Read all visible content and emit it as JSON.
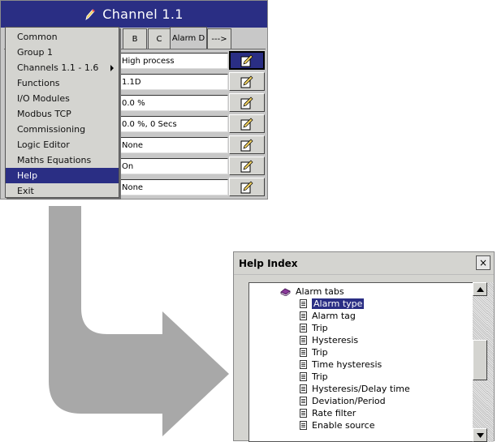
{
  "channel_window": {
    "title": "Channel 1.1",
    "title_icon": "pen-icon",
    "tabs": [
      "B",
      "C",
      "Alarm D",
      "--->"
    ],
    "active_tab": "Alarm D",
    "fields": [
      "High process",
      "1.1D",
      "0.0 %",
      "0.0 %, 0 Secs",
      "None",
      "On",
      "None"
    ],
    "edit_icon": "edit-pencil-icon"
  },
  "menu": {
    "items": [
      {
        "label": "Common"
      },
      {
        "label": "Group 1"
      },
      {
        "label": "Channels 1.1 - 1.6",
        "submenu": true
      },
      {
        "label": "Functions"
      },
      {
        "label": "I/O Modules"
      },
      {
        "label": "Modbus TCP"
      },
      {
        "label": "Commissioning"
      },
      {
        "label": "Logic Editor"
      },
      {
        "label": "Maths Equations"
      },
      {
        "label": "Help",
        "highlighted": true
      },
      {
        "label": "Exit"
      }
    ]
  },
  "help_window": {
    "title": "Help Index",
    "close": "×",
    "items": [
      {
        "label": "Alarm tabs",
        "icon": "book-icon"
      },
      {
        "label": "Alarm type",
        "icon": "doc-icon",
        "selected": true
      },
      {
        "label": "Alarm tag",
        "icon": "doc-icon"
      },
      {
        "label": "Trip",
        "icon": "doc-icon"
      },
      {
        "label": "Hysteresis",
        "icon": "doc-icon"
      },
      {
        "label": "Trip",
        "icon": "doc-icon"
      },
      {
        "label": "Time hysteresis",
        "icon": "doc-icon"
      },
      {
        "label": "Trip",
        "icon": "doc-icon"
      },
      {
        "label": "Hysteresis/Delay time",
        "icon": "doc-icon"
      },
      {
        "label": "Deviation/Period",
        "icon": "doc-icon"
      },
      {
        "label": "Rate filter",
        "icon": "doc-icon"
      },
      {
        "label": "Enable source",
        "icon": "doc-icon"
      }
    ]
  },
  "colors": {
    "title_bar": "#2a2e84",
    "arrow": "#a8a8a8",
    "selection": "#2a2e84"
  }
}
